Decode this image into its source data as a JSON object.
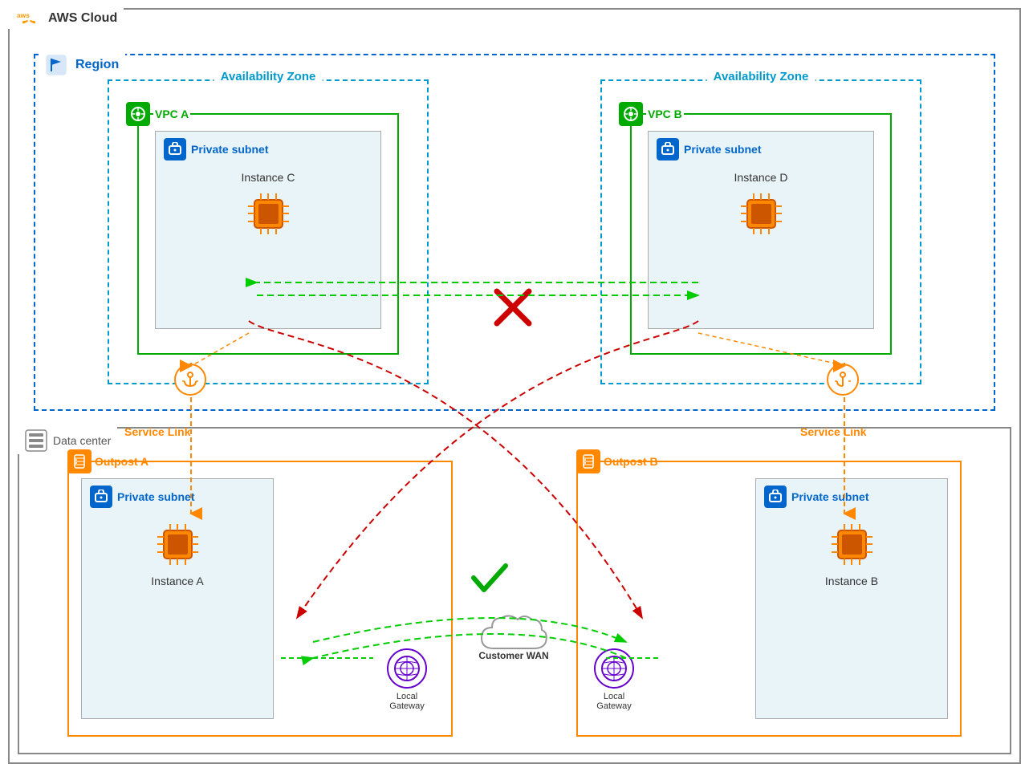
{
  "aws": {
    "cloud_label": "AWS Cloud",
    "region_label": "Region",
    "az_label": "Availability Zone",
    "vpc_a_label": "VPC A",
    "vpc_b_label": "VPC B",
    "private_subnet_label": "Private subnet",
    "instance_c_label": "Instance C",
    "instance_d_label": "Instance D",
    "instance_a_label": "Instance A",
    "instance_b_label": "Instance B",
    "datacenter_label": "Data center",
    "outpost_a_label": "Outpost A",
    "outpost_b_label": "Outpost B",
    "service_link_label": "Service Link",
    "local_gateway_label": "Local\nGateway",
    "customer_wan_label": "Customer WAN"
  }
}
